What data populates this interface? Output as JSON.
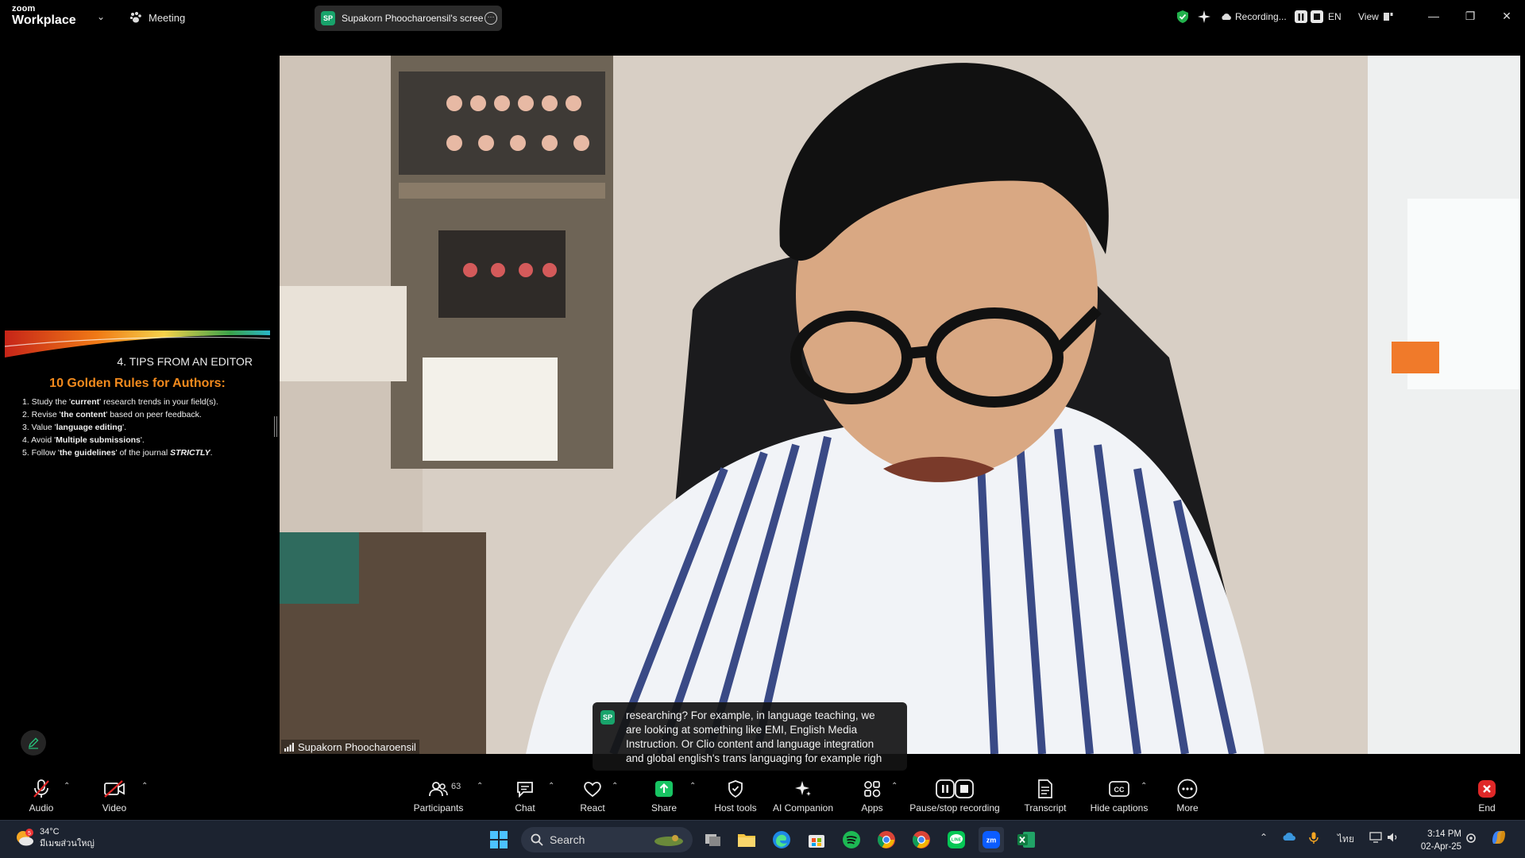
{
  "titlebar": {
    "app_small": "zoom",
    "app_name": "Workplace",
    "meeting_label": "Meeting",
    "share_pill": {
      "badge": "SP",
      "label": "Supakorn Phoocharoensil's scree"
    },
    "recording_label": "Recording...",
    "language": "EN",
    "view_label": "View"
  },
  "slide": {
    "section_title": "4. TIPS FROM AN EDITOR",
    "heading": "10 Golden Rules for Authors:",
    "rules": [
      {
        "pre": "1. Study the '",
        "bold": "current",
        "post": "' research trends in your field(s)."
      },
      {
        "pre": "2. Revise '",
        "bold": "the content",
        "post": "' based on peer feedback."
      },
      {
        "pre": "3. Value '",
        "bold": "language editing",
        "post": "'."
      },
      {
        "pre": "4. Avoid '",
        "bold": "Multiple submissions",
        "post": "'."
      },
      {
        "pre": "5. Follow '",
        "bold": "the guidelines",
        "post": "' of the journal ",
        "tail": "STRICTLY",
        "end": "."
      }
    ]
  },
  "video": {
    "participant_name": "Supakorn Phoocharoensil"
  },
  "caption": {
    "badge": "SP",
    "lines": [
      "researching? For example, in language teaching, we",
      "are looking at something like EMI, English Media",
      "Instruction. Or Clio content and language integration",
      "and global english's trans languaging for example righ"
    ]
  },
  "toolbar": {
    "audio": "Audio",
    "video": "Video",
    "participants": "Participants",
    "participants_count": "63",
    "chat": "Chat",
    "react": "React",
    "share": "Share",
    "host_tools": "Host tools",
    "ai_companion": "AI Companion",
    "apps": "Apps",
    "pause_recording": "Pause/stop recording",
    "transcript": "Transcript",
    "hide_captions": "Hide captions",
    "more": "More",
    "end": "End"
  },
  "taskbar": {
    "weather_temp": "34°C",
    "weather_desc": "มีเมฆส่วนใหญ่",
    "search_label": "Search",
    "ime": "ไทย",
    "time": "3:14 PM",
    "date": "02-Apr-25",
    "colors": {
      "zoom": "#0b5cff",
      "spotify": "#1db954",
      "line": "#06c755",
      "excel": "#107c41"
    }
  },
  "colors": {
    "share_green": "#18c463",
    "end_red": "#e02828",
    "slide_heading": "#f28a1d"
  }
}
